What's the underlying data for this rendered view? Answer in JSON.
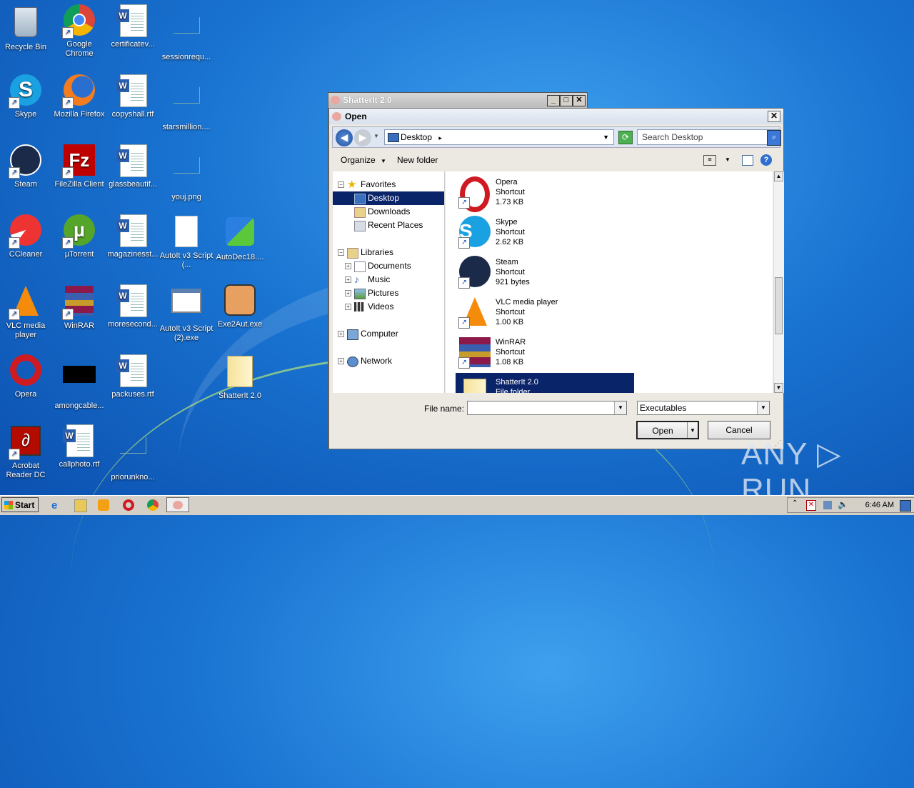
{
  "desktop": {
    "icons": [
      {
        "label": "Recycle Bin"
      },
      {
        "label": "Google Chrome"
      },
      {
        "label": "certificatev..."
      },
      {
        "label": "sessionrequ..."
      },
      {
        "label": "Skype"
      },
      {
        "label": "Mozilla Firefox"
      },
      {
        "label": "copyshall.rtf"
      },
      {
        "label": "starsmillion...."
      },
      {
        "label": "Steam"
      },
      {
        "label": "FileZilla Client"
      },
      {
        "label": "glassbeautif..."
      },
      {
        "label": "youj.png"
      },
      {
        "label": "CCleaner"
      },
      {
        "label": "µTorrent"
      },
      {
        "label": "magazinesst..."
      },
      {
        "label": "AutoIt v3 Script (..."
      },
      {
        "label": "AutoDec18...."
      },
      {
        "label": "VLC media player"
      },
      {
        "label": "WinRAR"
      },
      {
        "label": "moresecond..."
      },
      {
        "label": "AutoIt v3 Script (2).exe"
      },
      {
        "label": "Exe2Aut.exe"
      },
      {
        "label": "Opera"
      },
      {
        "label": "amongcable..."
      },
      {
        "label": "packuses.rtf"
      },
      {
        "label": "ShatterIt 2.0"
      },
      {
        "label": "Acrobat Reader DC"
      },
      {
        "label": "callphoto.rtf"
      },
      {
        "label": "priorunkno..."
      }
    ]
  },
  "shatter_window": {
    "title": "ShatterIt 2.0",
    "min": "_",
    "max": "□",
    "close": "✕"
  },
  "dialog": {
    "title": "Open",
    "close": "✕",
    "address": "Desktop",
    "address_arrow": "▸",
    "search_placeholder": "Search Desktop",
    "toolbar": {
      "organize": "Organize",
      "new_folder": "New folder"
    },
    "nav": {
      "favorites": "Favorites",
      "desktop": "Desktop",
      "downloads": "Downloads",
      "recent": "Recent Places",
      "libraries": "Libraries",
      "documents": "Documents",
      "music": "Music",
      "pictures": "Pictures",
      "videos": "Videos",
      "computer": "Computer",
      "network": "Network"
    },
    "files": [
      {
        "name": "Opera",
        "type": "Shortcut",
        "size": "1.73 KB"
      },
      {
        "name": "Skype",
        "type": "Shortcut",
        "size": "2.62 KB"
      },
      {
        "name": "Steam",
        "type": "Shortcut",
        "size": "921 bytes"
      },
      {
        "name": "VLC media player",
        "type": "Shortcut",
        "size": "1.00 KB"
      },
      {
        "name": "WinRAR",
        "type": "Shortcut",
        "size": "1.08 KB"
      },
      {
        "name": "ShatterIt 2.0",
        "type": "File folder",
        "size": ""
      }
    ],
    "file_name_label": "File name:",
    "file_name_value": "",
    "file_type": "Executables",
    "open_label": "Open",
    "cancel_label": "Cancel"
  },
  "taskbar": {
    "start": "Start",
    "clock": "6:46 AM"
  },
  "watermark": "ANY ▷ RUN"
}
